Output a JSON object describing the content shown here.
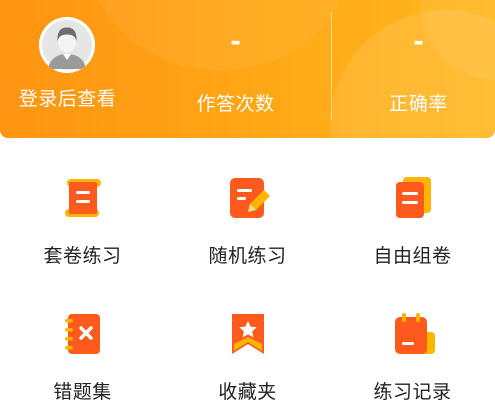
{
  "header": {
    "login_text": "登录后查看",
    "stats": [
      {
        "value": "-",
        "label": "作答次数"
      },
      {
        "value": "-",
        "label": "正确率"
      }
    ]
  },
  "menu": [
    {
      "label": "套卷练习",
      "icon": "paper-scroll-icon"
    },
    {
      "label": "随机练习",
      "icon": "edit-note-icon"
    },
    {
      "label": "自由组卷",
      "icon": "stacked-papers-icon"
    },
    {
      "label": "错题集",
      "icon": "wrong-notebook-icon"
    },
    {
      "label": "收藏夹",
      "icon": "bookmark-star-icon"
    },
    {
      "label": "练习记录",
      "icon": "calendar-record-icon"
    }
  ],
  "colors": {
    "banner_start": "#ff9412",
    "banner_end": "#ffb71e",
    "icon_orange": "#ff5a1e",
    "icon_yellow": "#ffb400"
  }
}
